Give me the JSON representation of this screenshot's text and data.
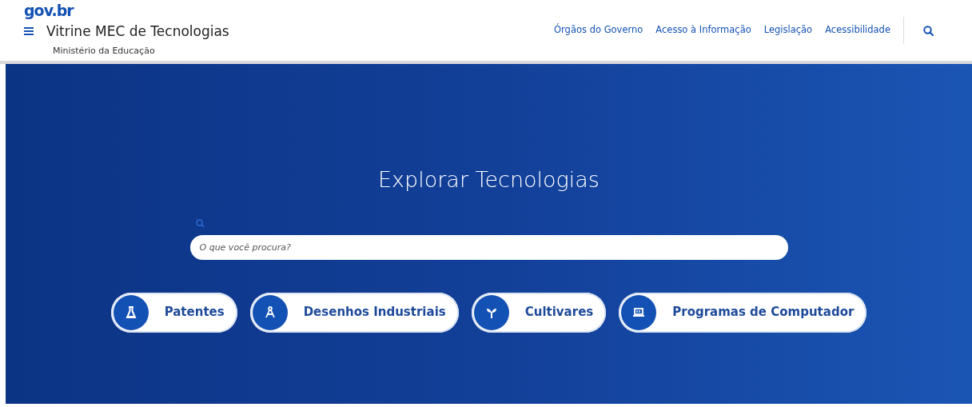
{
  "header": {
    "logo": "gov.br",
    "title": "Vitrine MEC de Tecnologias",
    "subtitle": "Ministério da Educação",
    "links": [
      "Órgãos do Governo",
      "Acesso à Informação",
      "Legislação",
      "Acessibilidade"
    ]
  },
  "hero": {
    "title": "Explorar Tecnologias",
    "search": {
      "placeholder": "O que você procura?"
    },
    "categories": [
      {
        "label": "Patentes",
        "kind": "flask"
      },
      {
        "label": "Desenhos Industriais",
        "kind": "compass"
      },
      {
        "label": "Cultivares",
        "kind": "sprout"
      },
      {
        "label": "Programas de Computador",
        "kind": "laptop"
      }
    ]
  }
}
